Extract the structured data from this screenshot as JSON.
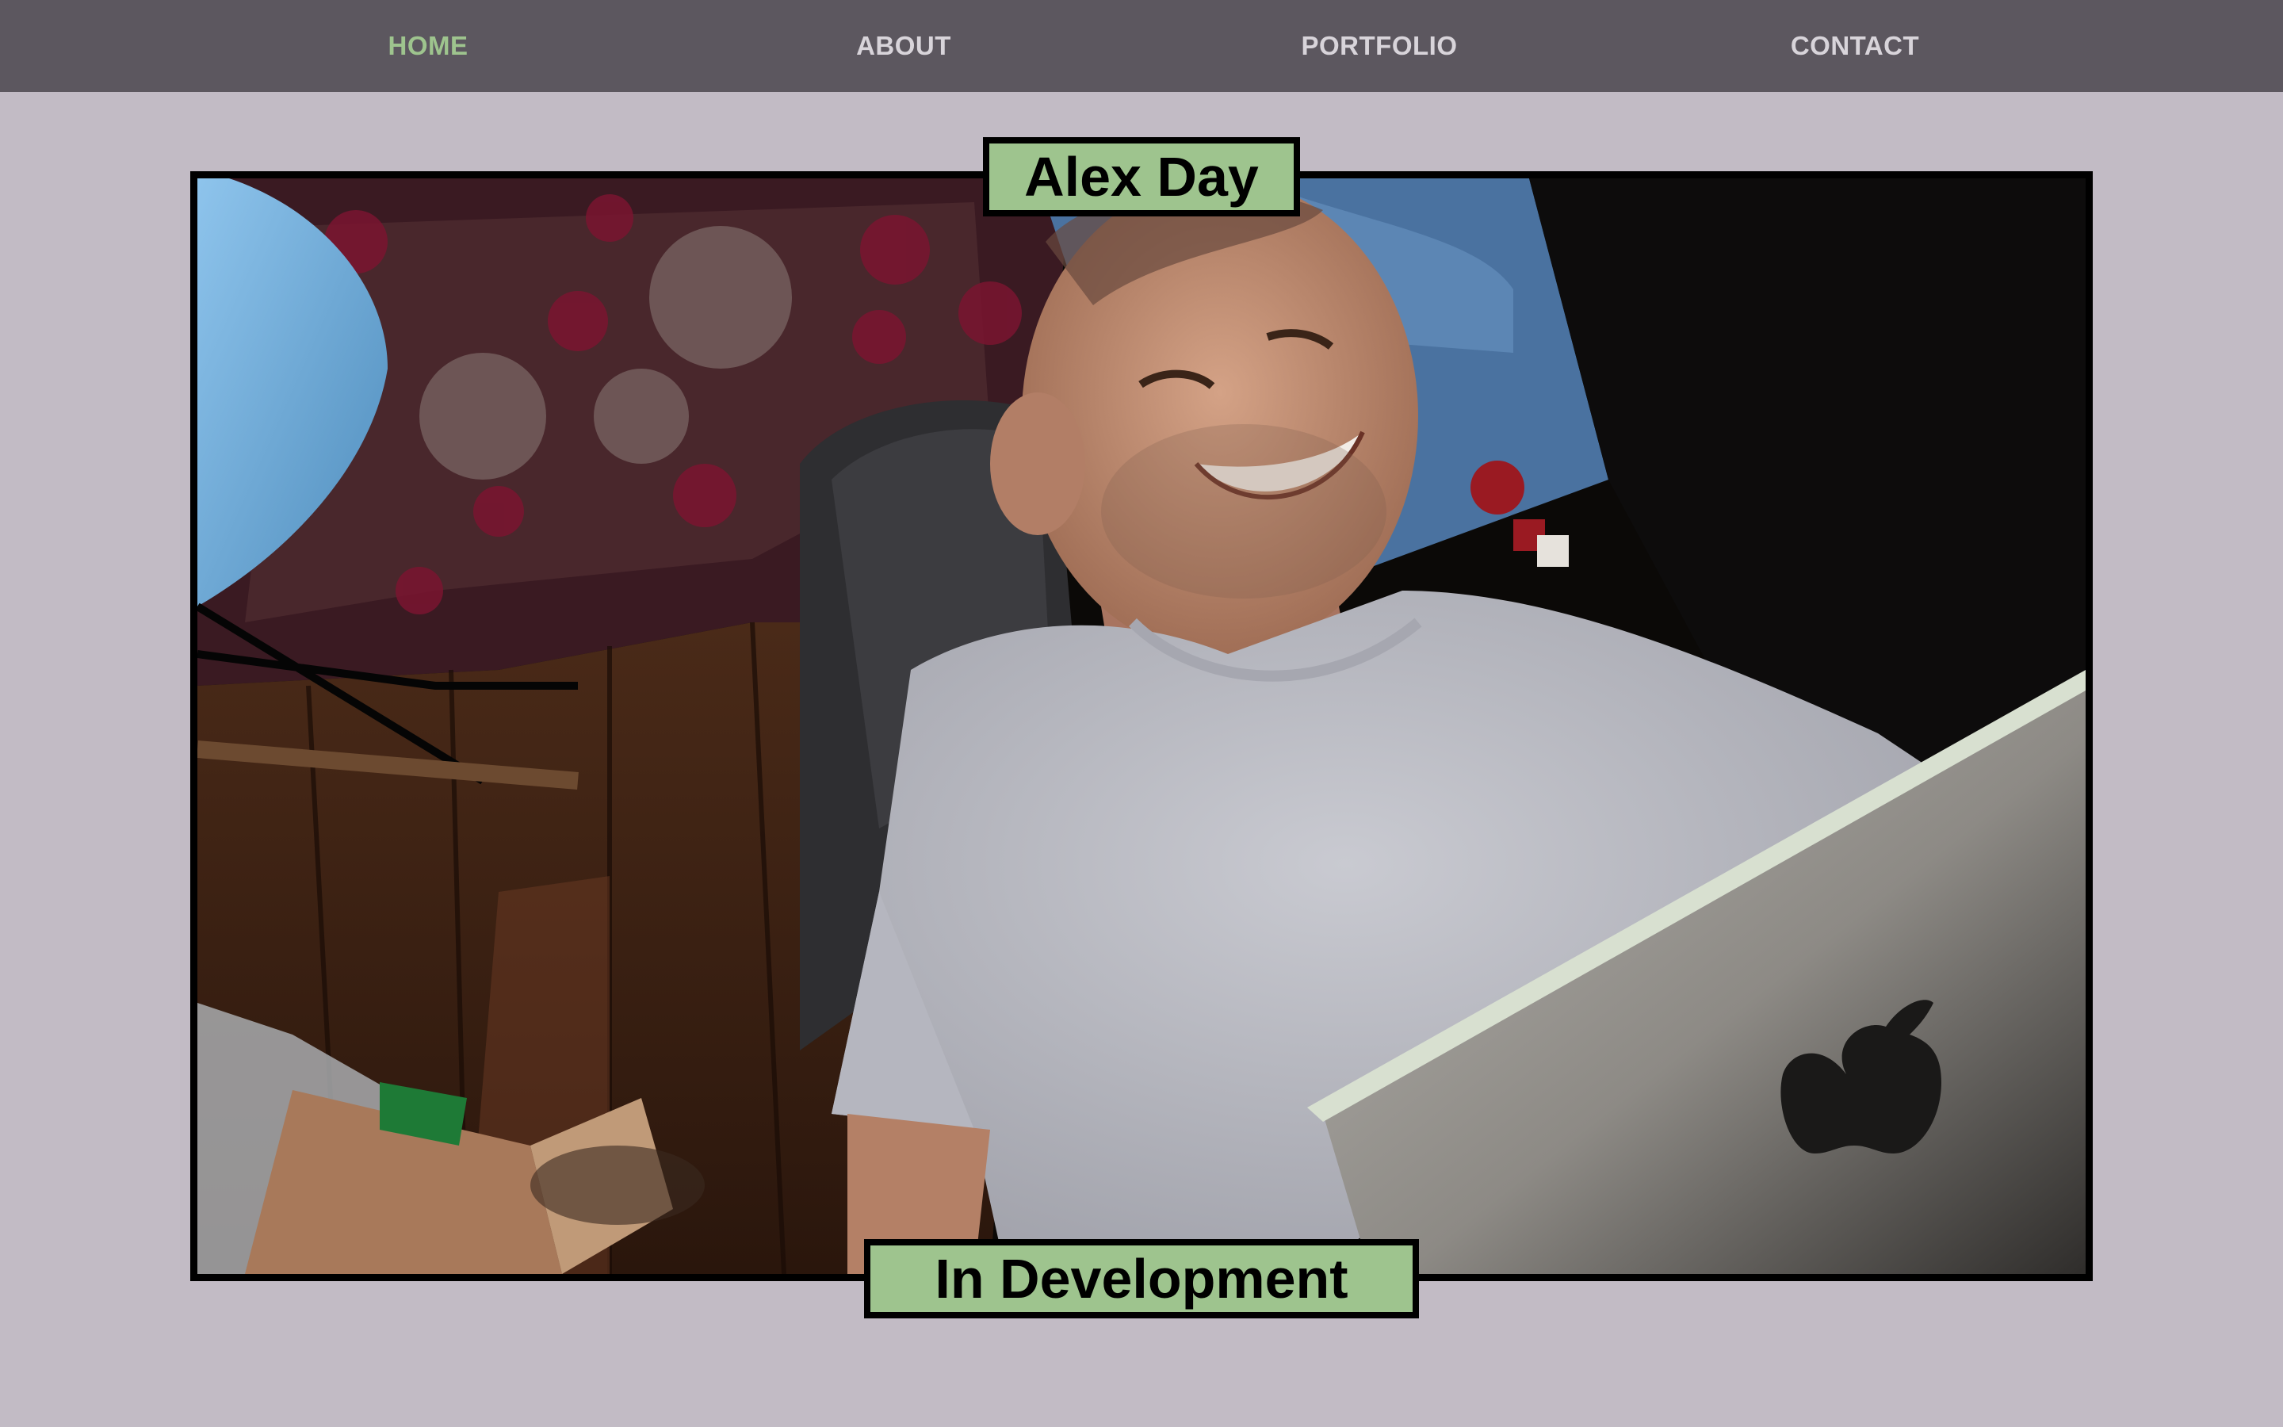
{
  "nav": {
    "items": [
      {
        "label": "HOME",
        "active": true
      },
      {
        "label": "ABOUT",
        "active": false
      },
      {
        "label": "PORTFOLIO",
        "active": false
      },
      {
        "label": "CONTACT",
        "active": false
      }
    ]
  },
  "hero": {
    "title": "Alex Day",
    "status": "In Development"
  },
  "colors": {
    "page_background": "#c2bbc5",
    "navbar_background": "#5c575f",
    "nav_text": "#d8d4da",
    "accent_green": "#9ec48e",
    "frame_border": "#000000"
  }
}
